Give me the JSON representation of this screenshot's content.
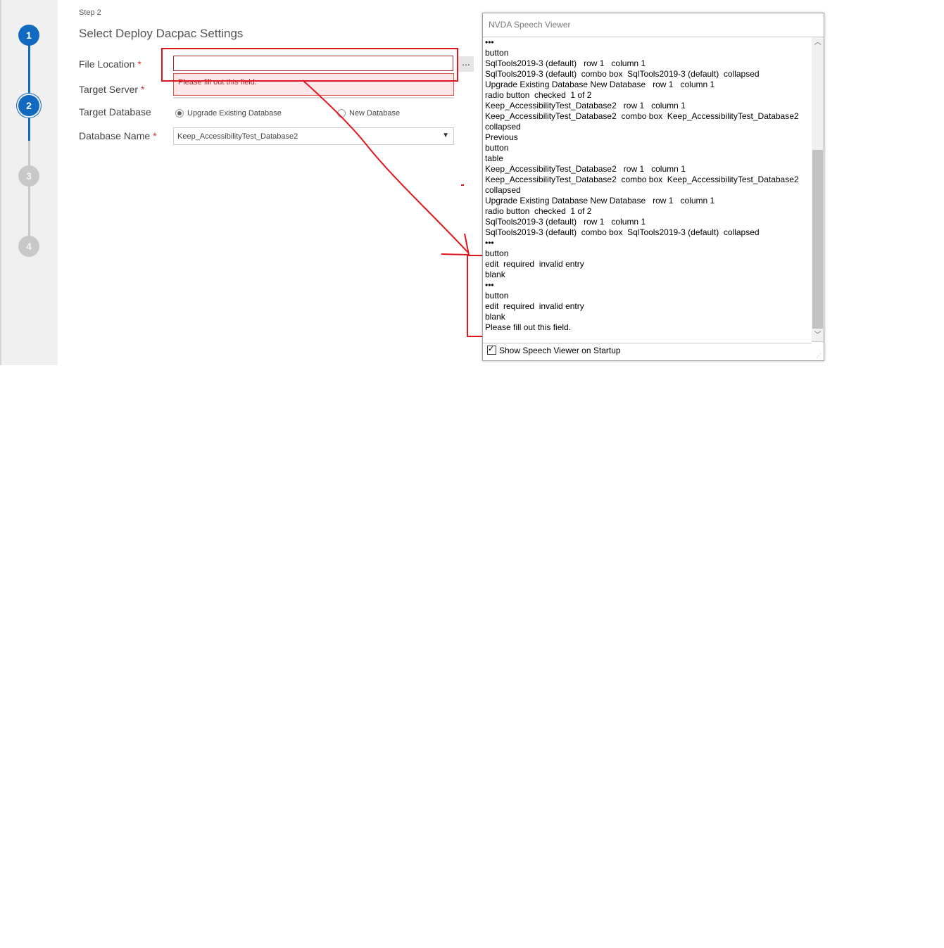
{
  "stepper": {
    "steps": [
      {
        "number": "1",
        "state": "done"
      },
      {
        "number": "2",
        "state": "current"
      },
      {
        "number": "3",
        "state": "todo"
      },
      {
        "number": "4",
        "state": "todo"
      }
    ],
    "accent_color": "#1269c0"
  },
  "form": {
    "step_caption": "Step 2",
    "title": "Select Deploy Dacpac Settings",
    "required_mark": "*",
    "file_location": {
      "label": "File Location",
      "value": "",
      "browse_label": "...",
      "error": "Please fill out this field."
    },
    "target_server": {
      "label": "Target Server"
    },
    "target_database": {
      "label": "Target Database",
      "options": [
        {
          "label": "Upgrade Existing Database",
          "checked": true
        },
        {
          "label": "New Database",
          "checked": false
        }
      ]
    },
    "database_name": {
      "label": "Database Name",
      "value": "Keep_AccessibilityTest_Database2"
    },
    "error_color": "#a4262c"
  },
  "annotation_color": "#e0161f",
  "nvda": {
    "title": "NVDA Speech Viewer",
    "log_lines": [
      "•••",
      "button",
      "SqlTools2019-3 (default)   row 1   column 1",
      "SqlTools2019-3 (default)  combo box  SqlTools2019-3 (default)  collapsed",
      "Upgrade Existing Database New Database   row 1   column 1",
      "radio button  checked  1 of 2",
      "Keep_AccessibilityTest_Database2   row 1   column 1",
      "Keep_AccessibilityTest_Database2  combo box  Keep_AccessibilityTest_Database2",
      "collapsed",
      "Previous",
      "button",
      "table",
      "Keep_AccessibilityTest_Database2   row 1   column 1",
      "Keep_AccessibilityTest_Database2  combo box  Keep_AccessibilityTest_Database2",
      "collapsed",
      "Upgrade Existing Database New Database   row 1   column 1",
      "radio button  checked  1 of 2",
      "SqlTools2019-3 (default)   row 1   column 1",
      "SqlTools2019-3 (default)  combo box  SqlTools2019-3 (default)  collapsed",
      "•••",
      "button",
      "edit  required  invalid entry",
      "blank",
      "•••",
      "button",
      "edit  required  invalid entry",
      "blank",
      "Please fill out this field."
    ],
    "show_on_startup_label": "Show Speech Viewer on Startup",
    "show_on_startup_checked": true
  }
}
